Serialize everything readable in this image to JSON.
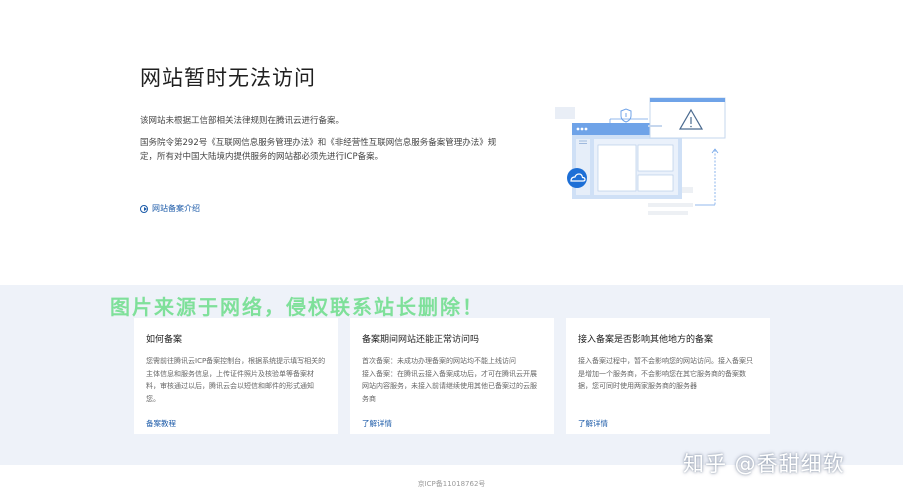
{
  "main": {
    "title": "网站暂时无法访问",
    "paragraph1": "该网站未根据工信部相关法律规则在腾讯云进行备案。",
    "paragraph2": "国务院令第292号《互联网信息服务管理办法》和《非经营性互联网信息服务备案管理办法》规定，所有对中国大陆境内提供服务的网站都必须先进行ICP备案。",
    "intro_link": "网站备案介绍"
  },
  "watermark": "图片来源于网络，侵权联系站长删除！",
  "cards": [
    {
      "title": "如何备案",
      "body": "您需前往腾讯云ICP备案控制台，根据系统提示填写相关的主体信息和服务信息，上传证件照片及核验单等备案材料，审核通过以后，腾讯云会以短信和邮件的形式通知您。",
      "link": "备案教程"
    },
    {
      "title": "备案期间网站还能正常访问吗",
      "body": "首次备案：未成功办理备案的网站均不能上线访问\n接入备案：在腾讯云接入备案成功后，才可在腾讯云开展网站内容服务，未接入前请继续使用其他已备案过的云服务商",
      "link": "了解详情"
    },
    {
      "title": "接入备案是否影响其他地方的备案",
      "body": "接入备案过程中，暂不会影响您的网站访问。接入备案只是增加一个服务商，不会影响您在其它服务商的备案数据，您可同时使用两家服务商的服务器",
      "link": "了解详情"
    }
  ],
  "footer": {
    "icp": "京ICP备11018762号"
  },
  "credit": "知乎 @香甜细软",
  "colors": {
    "link": "#1b5aa8",
    "band": "#eef2f9",
    "watermark": "#7fe09a"
  },
  "icons": [
    "play-circle-icon",
    "shield-icon",
    "warning-triangle-icon",
    "cloud-icon"
  ]
}
